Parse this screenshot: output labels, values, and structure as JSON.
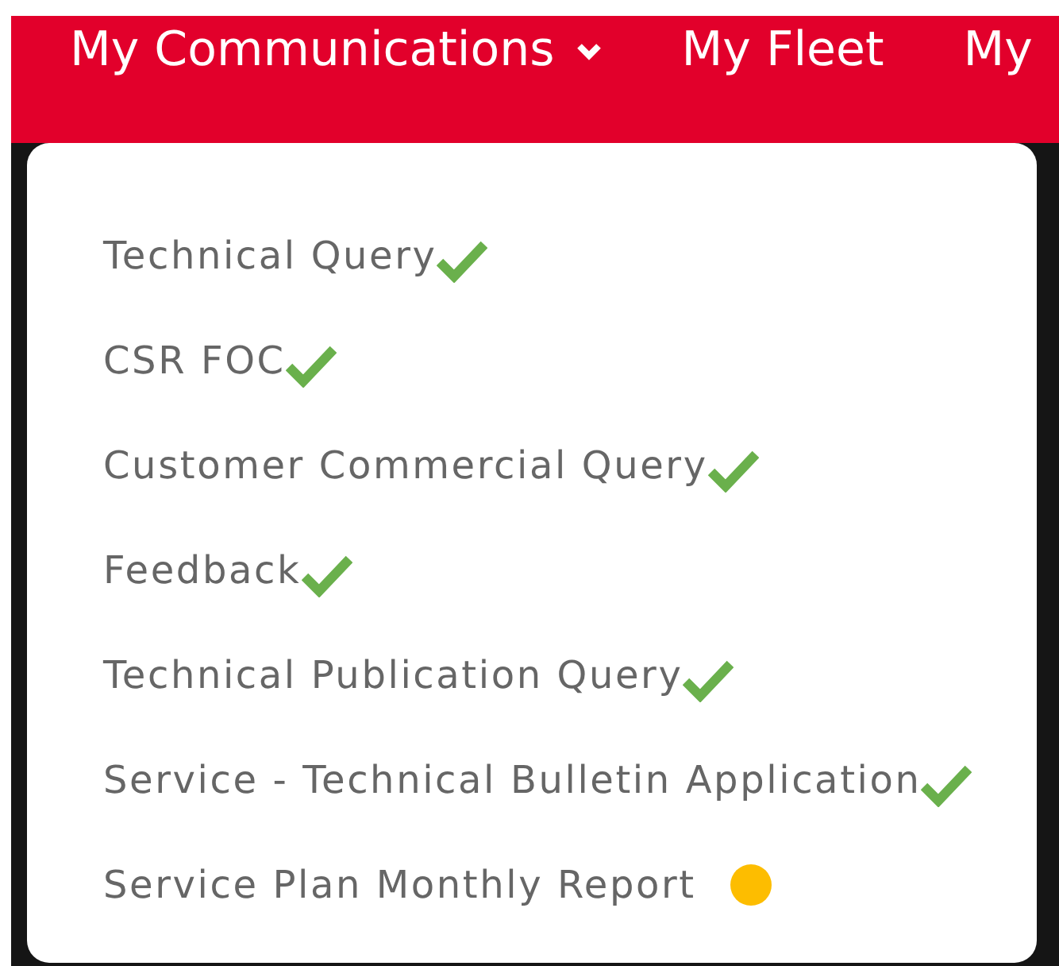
{
  "nav": {
    "items": [
      {
        "label": "My Communications",
        "expanded": true
      },
      {
        "label": "My Fleet",
        "expanded": false
      },
      {
        "label": "My"
      }
    ]
  },
  "menu": {
    "items": [
      {
        "label": "Technical Query",
        "kind": "check"
      },
      {
        "label": "CSR FOC",
        "kind": "check"
      },
      {
        "label": "Customer Commercial Query",
        "kind": "check"
      },
      {
        "label": "Feedback",
        "kind": "check"
      },
      {
        "label": "Technical Publication Query",
        "kind": "check"
      },
      {
        "label": "Service - Technical Bulletin Application",
        "kind": "check"
      },
      {
        "label": "Service Plan Monthly Report",
        "kind": "dot"
      }
    ]
  }
}
